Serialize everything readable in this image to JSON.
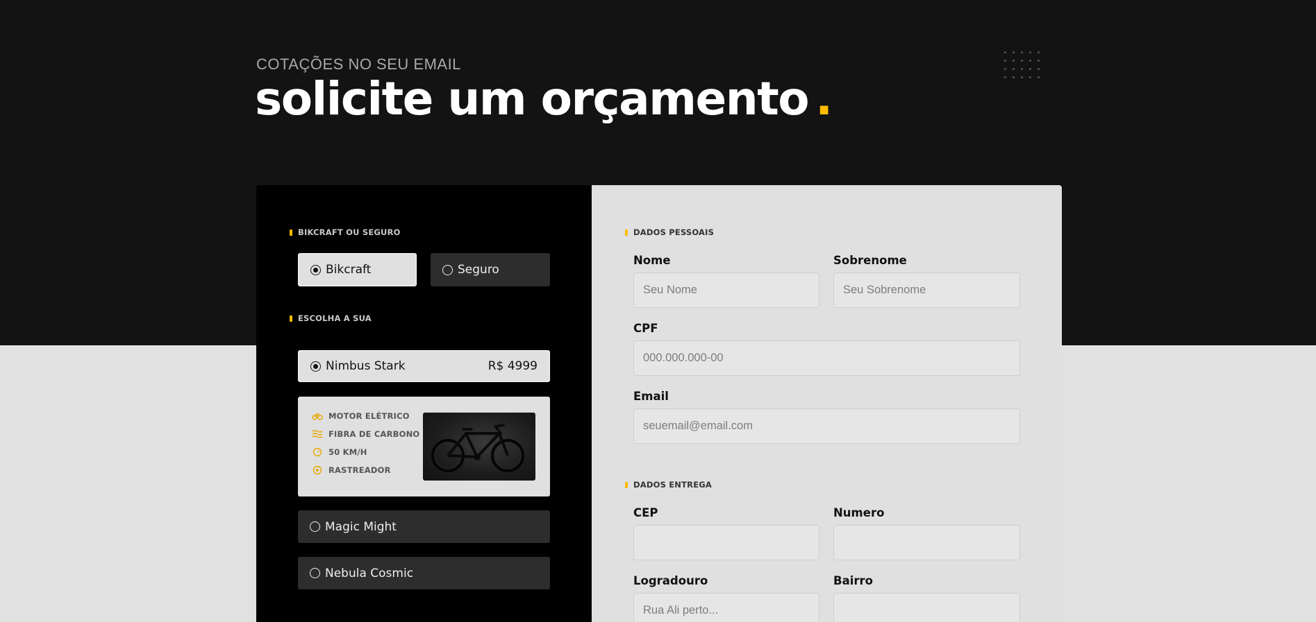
{
  "header": {
    "subtitle": "COTAÇÕES NO SEU EMAIL",
    "title": "solicite um orçamento",
    "title_dot": "."
  },
  "left": {
    "section_type": "BIKCRAFT OU SEGURO",
    "type_options": [
      {
        "label": "Bikcraft",
        "selected": true
      },
      {
        "label": "Seguro",
        "selected": false
      }
    ],
    "section_choose": "ESCOLHA A SUA",
    "bikes": [
      {
        "name": "Nimbus Stark",
        "price": "R$ 4999",
        "selected": true
      },
      {
        "name": "Magic Might",
        "selected": false
      },
      {
        "name": "Nebula Cosmic",
        "selected": false
      }
    ],
    "features": [
      {
        "icon": "bike-motor-icon",
        "label": "MOTOR ELÉTRICO"
      },
      {
        "icon": "carbon-fiber-icon",
        "label": "FIBRA DE CARBONO"
      },
      {
        "icon": "speedometer-icon",
        "label": "50 KM/H"
      },
      {
        "icon": "tracker-icon",
        "label": "RASTREADOR"
      }
    ]
  },
  "right": {
    "section_personal": "DADOS PESSOAIS",
    "nome_label": "Nome",
    "nome_placeholder": "Seu Nome",
    "sobrenome_label": "Sobrenome",
    "sobrenome_placeholder": "Seu Sobrenome",
    "cpf_label": "CPF",
    "cpf_placeholder": "000.000.000-00",
    "email_label": "Email",
    "email_placeholder": "seuemail@email.com",
    "section_delivery": "DADOS ENTREGA",
    "cep_label": "CEP",
    "cep_placeholder": "",
    "numero_label": "Numero",
    "numero_placeholder": "",
    "logradouro_label": "Logradouro",
    "logradouro_placeholder": "Rua Ali perto...",
    "bairro_label": "Bairro",
    "bairro_placeholder": ""
  },
  "colors": {
    "accent": "#ffbb00",
    "dark_bg": "#131313",
    "panel_black": "#000000",
    "light_bg": "#e1e1e1"
  }
}
